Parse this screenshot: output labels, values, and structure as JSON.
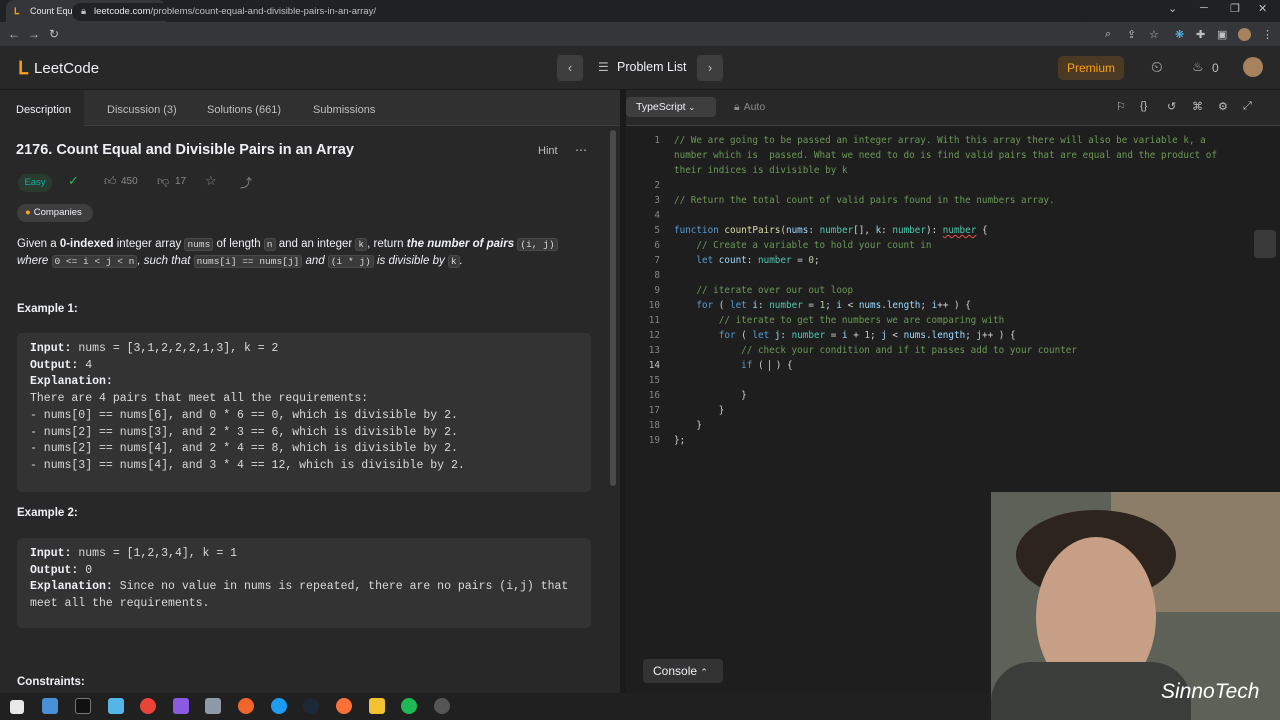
{
  "browser": {
    "tab_title": "Count Equal and Divisible Pairs in...",
    "url_domain": "leetcode.com",
    "url_path": "/problems/count-equal-and-divisible-pairs-in-an-array/"
  },
  "header": {
    "logo_text": "LeetCode",
    "problem_list": "Problem List",
    "premium": "Premium",
    "streak": "0"
  },
  "left_tabs": [
    "Description",
    "Discussion (3)",
    "Solutions (661)",
    "Submissions"
  ],
  "problem": {
    "title": "2176. Count Equal and Divisible Pairs in an Array",
    "hint": "Hint",
    "difficulty": "Easy",
    "likes": "450",
    "dislikes": "17",
    "companies": "Companies",
    "desc": {
      "t1": "Given a ",
      "t2": "0-indexed",
      "t3": " integer array ",
      "c1": "nums",
      "t4": " of length ",
      "c2": "n",
      "t5": " and an integer ",
      "c3": "k",
      "t6": ", return ",
      "t7": "the number of pairs",
      "c4": "(i, j)",
      "t8": "where",
      "c5": "0 <= i < j < n",
      "t9": ", such that",
      "c6": "nums[i] == nums[j]",
      "t10": "and",
      "c7": "(i * j)",
      "t11": "is divisible by",
      "c8": "k",
      "t12": "."
    },
    "example1": {
      "heading": "Example 1:",
      "input_label": "Input:",
      "input": " nums = [3,1,2,2,2,1,3], k = 2",
      "output_label": "Output:",
      "output": " 4",
      "expl_label": "Explanation:",
      "lines": [
        "There are 4 pairs that meet all the requirements:",
        "- nums[0] == nums[6], and 0 * 6 == 0, which is divisible by 2.",
        "- nums[2] == nums[3], and 2 * 3 == 6, which is divisible by 2.",
        "- nums[2] == nums[4], and 2 * 4 == 8, which is divisible by 2.",
        "- nums[3] == nums[4], and 3 * 4 == 12, which is divisible by 2."
      ]
    },
    "example2": {
      "heading": "Example 2:",
      "input_label": "Input:",
      "input": " nums = [1,2,3,4], k = 1",
      "output_label": "Output:",
      "output": " 0",
      "expl_label": "Explanation:",
      "expl1": " Since no value in nums is repeated, there are no pairs (i,j) that",
      "expl2": "meet all the requirements."
    },
    "constraints": "Constraints:"
  },
  "editor": {
    "language": "TypeScript",
    "auto": "Auto",
    "console": "Console",
    "current_line": 14
  },
  "watermark": "SinnoTech",
  "colors": {
    "accent": "#ffa116",
    "easy": "#00b8a3",
    "comment": "#6a9955",
    "keyword": "#569cd6"
  }
}
